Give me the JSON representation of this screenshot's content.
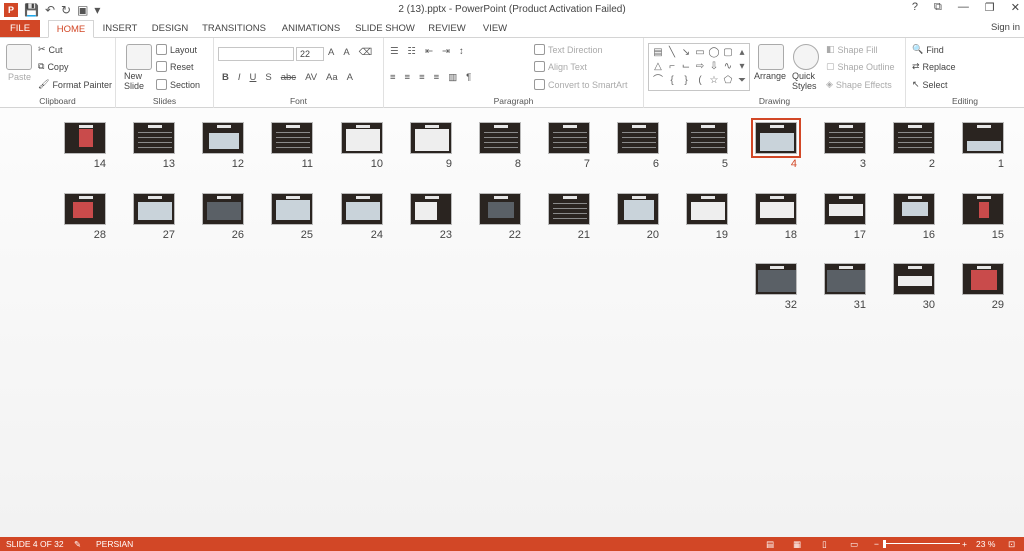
{
  "window": {
    "title": "2 (13).pptx - PowerPoint (Product Activation Failed)",
    "controls": [
      "?",
      "⧉",
      "—",
      "❐",
      "✕"
    ]
  },
  "tabs": [
    "FILE",
    "HOME",
    "INSERT",
    "DESIGN",
    "TRANSITIONS",
    "ANIMATIONS",
    "SLIDE SHOW",
    "REVIEW",
    "VIEW"
  ],
  "signin": "Sign in",
  "ribbon": {
    "clipboard": {
      "label": "Clipboard",
      "paste": "Paste",
      "cut": "Cut",
      "copy": "Copy",
      "format_painter": "Format Painter"
    },
    "slides": {
      "label": "Slides",
      "new_slide": "New Slide",
      "layout": "Layout",
      "reset": "Reset",
      "section": "Section"
    },
    "font": {
      "label": "Font",
      "font_name": "",
      "font_size": "22",
      "bold": "B",
      "italic": "I",
      "underline": "U",
      "shadow": "S",
      "strike": "abc",
      "spacing": "AV",
      "case": "Aa",
      "color": "A"
    },
    "paragraph": {
      "label": "Paragraph",
      "text_direction": "Text Direction",
      "align_text": "Align Text",
      "smartart": "Convert to SmartArt"
    },
    "drawing": {
      "label": "Drawing",
      "arrange": "Arrange",
      "quick_styles": "Quick Styles",
      "shape_fill": "Shape Fill",
      "shape_outline": "Shape Outline",
      "shape_effects": "Shape Effects"
    },
    "editing": {
      "label": "Editing",
      "find": "Find",
      "replace": "Replace",
      "select": "Select"
    }
  },
  "slides": {
    "row1": [
      "14",
      "13",
      "12",
      "11",
      "10",
      "9",
      "8",
      "7",
      "6",
      "5",
      "4",
      "3",
      "2",
      "1"
    ],
    "row2": [
      "28",
      "27",
      "26",
      "25",
      "24",
      "23",
      "22",
      "21",
      "20",
      "19",
      "18",
      "17",
      "16",
      "15"
    ],
    "row3": [
      "32",
      "31",
      "30",
      "29"
    ],
    "selected": "4"
  },
  "statusbar": {
    "slide_info": "SLIDE 4 OF 32",
    "language": "PERSIAN",
    "zoom": "23 %",
    "minus": "−",
    "plus": "+"
  },
  "colors": {
    "accent": "#d24726",
    "thumb_bg": "#2a2420"
  }
}
